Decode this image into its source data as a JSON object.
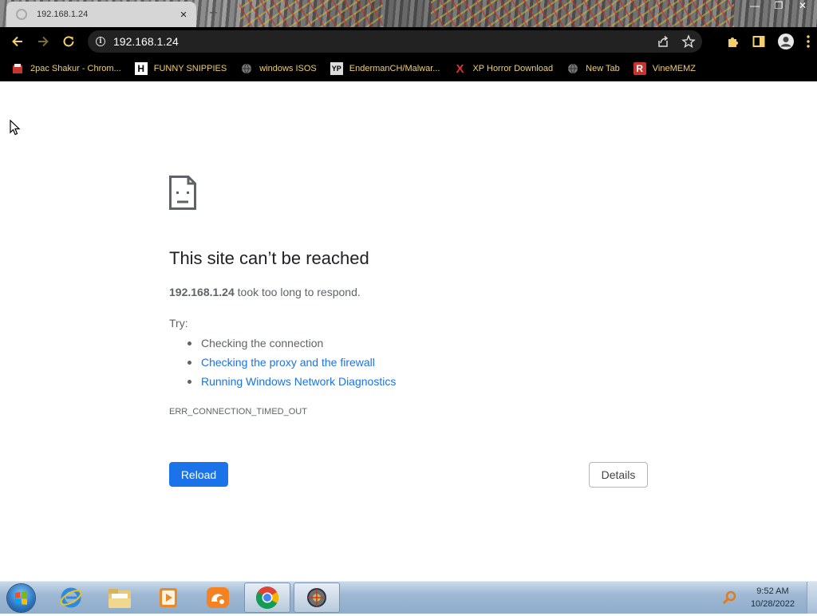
{
  "browser": {
    "tab_title": "192.168.1.24",
    "url": "192.168.1.24",
    "new_tab_symbol": "+"
  },
  "bookmarks": [
    {
      "label": "2pac Shakur - Chrom...",
      "icon": "red-square-icon"
    },
    {
      "label": "FUNNY SNIPPIES",
      "icon": "h-letter-icon"
    },
    {
      "label": "windows ISOS",
      "icon": "globe-icon"
    },
    {
      "label": "EndermanCH/Malwar...",
      "icon": "yp-icon"
    },
    {
      "label": "XP Horror Download",
      "icon": "red-x-icon"
    },
    {
      "label": "New Tab",
      "icon": "globe-icon"
    },
    {
      "label": "VineMEMZ",
      "icon": "red-r-icon"
    }
  ],
  "error_page": {
    "title": "This site can’t be reached",
    "host": "192.168.1.24",
    "description_suffix": " took too long to respond.",
    "try_label": "Try:",
    "suggestions": [
      {
        "text": "Checking the connection",
        "link": false
      },
      {
        "text": "Checking the proxy and the firewall",
        "link": true
      },
      {
        "text": "Running Windows Network Diagnostics",
        "link": true
      }
    ],
    "error_code": "ERR_CONNECTION_TIMED_OUT",
    "reload_label": "Reload",
    "details_label": "Details"
  },
  "taskbar": {
    "time": "9:52 AM",
    "date": "10/28/2022",
    "apps": [
      "internet-explorer-icon",
      "file-explorer-icon",
      "media-player-icon",
      "uc-browser-icon",
      "chrome-icon",
      "app-icon"
    ]
  },
  "colors": {
    "link_blue": "#1a73e8",
    "bookmark_text": "#f0d06a",
    "toolbar_bg": "#000000"
  }
}
